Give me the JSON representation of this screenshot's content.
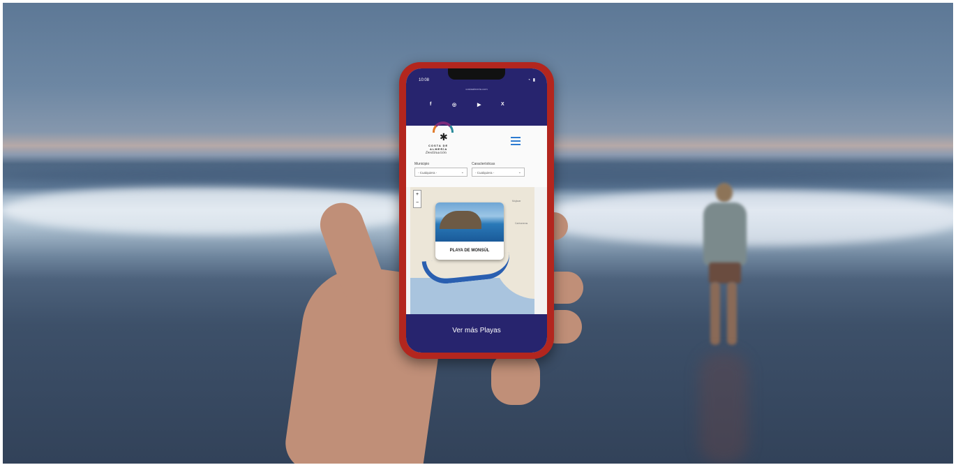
{
  "status_bar": {
    "time": "10:08",
    "icons": "◔ ▮"
  },
  "url": "costaalmeria.com",
  "socials": [
    {
      "icon": "facebook-icon",
      "glyph": "f"
    },
    {
      "icon": "instagram-icon",
      "glyph": "◎"
    },
    {
      "icon": "youtube-icon",
      "glyph": "▶"
    },
    {
      "icon": "x-icon",
      "glyph": "X"
    }
  ],
  "logo": {
    "line1": "COSTA DE",
    "line2": "ALMERÍA",
    "line3": "Destinación"
  },
  "filters": {
    "municipio_label": "Municipio",
    "municipio_value": "- Cualquiera -",
    "caracteristicas_label": "Características",
    "caracteristicas_value": "- Cualquiera -"
  },
  "map": {
    "zoom_in": "+",
    "zoom_out": "−",
    "popup_title": "PLAYA DE MONSÚL",
    "label_a": "Mojácar",
    "label_b": "Carboneras"
  },
  "footer": {
    "button_label": "Ver más Playas"
  },
  "colors": {
    "brand_navy": "#27246e",
    "phone_case": "#b3261e",
    "menu_blue": "#2d7bd1"
  }
}
